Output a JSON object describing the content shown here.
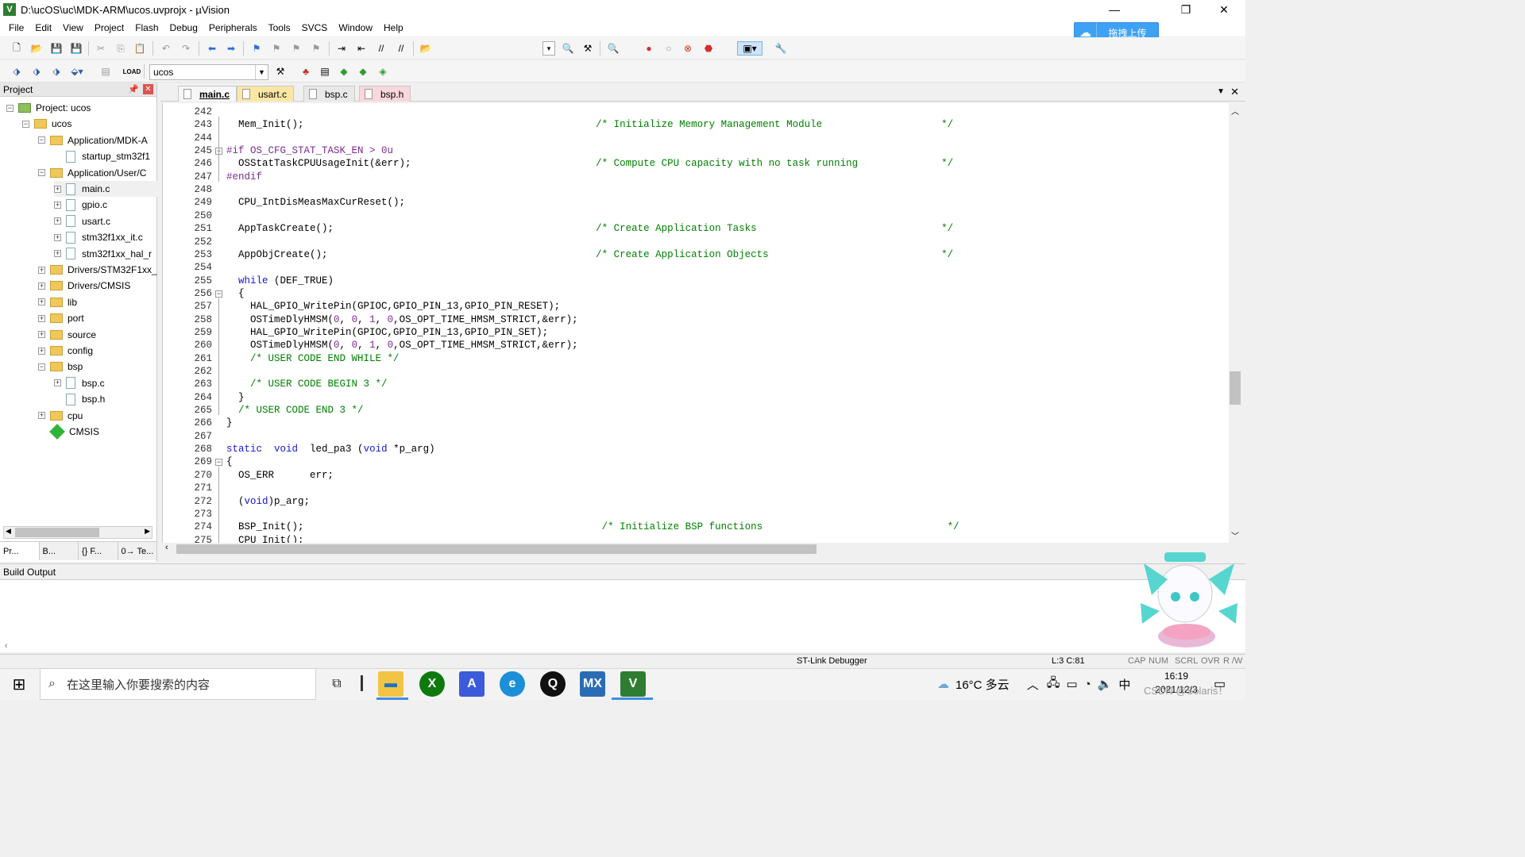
{
  "window": {
    "title": "D:\\ucOS\\uc\\MDK-ARM\\ucos.uvprojx - µVision",
    "minimize": "—",
    "maximize": "❐",
    "close": "✕"
  },
  "menu": [
    "File",
    "Edit",
    "View",
    "Project",
    "Flash",
    "Debug",
    "Peripherals",
    "Tools",
    "SVCS",
    "Window",
    "Help"
  ],
  "upload_button": {
    "label": "拖拽上传",
    "icon": "cloud-icon"
  },
  "toolbar2": {
    "target": "ucos"
  },
  "project_panel": {
    "title": "Project",
    "tree": [
      {
        "label": "Project: ucos",
        "icon": "project-icon",
        "expander": "−"
      },
      {
        "label": "ucos",
        "icon": "target-icon",
        "expander": "−"
      },
      {
        "label": "Application/MDK-A",
        "icon": "folder-icon",
        "expander": "−"
      },
      {
        "label": "startup_stm32f1",
        "icon": "file-icon",
        "expander": ""
      },
      {
        "label": "Application/User/C",
        "icon": "folder-icon",
        "expander": "−"
      },
      {
        "label": "main.c",
        "icon": "file-icon",
        "expander": "+"
      },
      {
        "label": "gpio.c",
        "icon": "file-icon",
        "expander": "+"
      },
      {
        "label": "usart.c",
        "icon": "file-icon",
        "expander": "+"
      },
      {
        "label": "stm32f1xx_it.c",
        "icon": "file-icon",
        "expander": "+"
      },
      {
        "label": "stm32f1xx_hal_r",
        "icon": "file-icon",
        "expander": "+"
      },
      {
        "label": "Drivers/STM32F1xx_",
        "icon": "folder-icon",
        "expander": "+"
      },
      {
        "label": "Drivers/CMSIS",
        "icon": "folder-icon",
        "expander": "+"
      },
      {
        "label": "lib",
        "icon": "folder-icon",
        "expander": "+"
      },
      {
        "label": "port",
        "icon": "folder-icon",
        "expander": "+"
      },
      {
        "label": "source",
        "icon": "folder-icon",
        "expander": "+"
      },
      {
        "label": "config",
        "icon": "folder-icon",
        "expander": "+"
      },
      {
        "label": "bsp",
        "icon": "folder-icon",
        "expander": "−"
      },
      {
        "label": "bsp.c",
        "icon": "file-icon",
        "expander": "+"
      },
      {
        "label": "bsp.h",
        "icon": "file-icon",
        "expander": ""
      },
      {
        "label": "cpu",
        "icon": "folder-icon",
        "expander": "+"
      },
      {
        "label": "CMSIS",
        "icon": "gem-icon",
        "expander": ""
      }
    ],
    "tabs": [
      "Pr...",
      "B...",
      "{} F...",
      "0→ Te..."
    ]
  },
  "editor": {
    "tabs": [
      {
        "label": "main.c",
        "color": "#f6f6f6",
        "active": true
      },
      {
        "label": "usart.c",
        "color": "#fbe7a5"
      },
      {
        "label": "bsp.c",
        "color": "#e9e9e9"
      },
      {
        "label": "bsp.h",
        "color": "#f9d7dc"
      }
    ],
    "lines": [
      {
        "n": "242",
        "t": ""
      },
      {
        "n": "243",
        "t": "  Mem_Init();                                                 /* Initialize Memory Management Module                    */"
      },
      {
        "n": "244",
        "t": ""
      },
      {
        "n": "245",
        "t": "#if OS_CFG_STAT_TASK_EN > 0u"
      },
      {
        "n": "246",
        "t": "  OSStatTaskCPUUsageInit(&err);                               /* Compute CPU capacity with no task running              */"
      },
      {
        "n": "247",
        "t": "#endif"
      },
      {
        "n": "248",
        "t": ""
      },
      {
        "n": "249",
        "t": "  CPU_IntDisMeasMaxCurReset();"
      },
      {
        "n": "250",
        "t": ""
      },
      {
        "n": "251",
        "t": "  AppTaskCreate();                                            /* Create Application Tasks                               */"
      },
      {
        "n": "252",
        "t": ""
      },
      {
        "n": "253",
        "t": "  AppObjCreate();                                             /* Create Application Objects                             */"
      },
      {
        "n": "254",
        "t": ""
      },
      {
        "n": "255",
        "t": "  while (DEF_TRUE)"
      },
      {
        "n": "256",
        "t": "  {"
      },
      {
        "n": "257",
        "t": "    HAL_GPIO_WritePin(GPIOC,GPIO_PIN_13,GPIO_PIN_RESET);"
      },
      {
        "n": "258",
        "t": "    OSTimeDlyHMSM(0, 0, 1, 0,OS_OPT_TIME_HMSM_STRICT,&err);"
      },
      {
        "n": "259",
        "t": "    HAL_GPIO_WritePin(GPIOC,GPIO_PIN_13,GPIO_PIN_SET);"
      },
      {
        "n": "260",
        "t": "    OSTimeDlyHMSM(0, 0, 1, 0,OS_OPT_TIME_HMSM_STRICT,&err);"
      },
      {
        "n": "261",
        "t": "    /* USER CODE END WHILE */"
      },
      {
        "n": "262",
        "t": ""
      },
      {
        "n": "263",
        "t": "    /* USER CODE BEGIN 3 */"
      },
      {
        "n": "264",
        "t": "  }"
      },
      {
        "n": "265",
        "t": "  /* USER CODE END 3 */"
      },
      {
        "n": "266",
        "t": "}"
      },
      {
        "n": "267",
        "t": ""
      },
      {
        "n": "268",
        "t": "static  void  led_pa3 (void *p_arg)"
      },
      {
        "n": "269",
        "t": "{"
      },
      {
        "n": "270",
        "t": "  OS_ERR      err;"
      },
      {
        "n": "271",
        "t": ""
      },
      {
        "n": "272",
        "t": "  (void)p_arg;"
      },
      {
        "n": "273",
        "t": ""
      },
      {
        "n": "274",
        "t": "  BSP_Init();                                                  /* Initialize BSP functions                               */"
      },
      {
        "n": "275",
        "t": "  CPU_Init();"
      }
    ]
  },
  "build_output": {
    "title": "Build Output"
  },
  "status": {
    "debugger": "ST-Link Debugger",
    "cursor": "L:3 C:81",
    "flags": [
      "CAP",
      "NUM",
      "SCRL",
      "OVR",
      "R /W"
    ]
  },
  "taskbar": {
    "search_placeholder": "在这里输入你要搜索的内容",
    "apps": [
      {
        "name": "task-view-icon",
        "glyph": "⧉"
      },
      {
        "name": "file-explorer-icon",
        "glyph": "▬"
      },
      {
        "name": "xbox-icon",
        "glyph": "X"
      },
      {
        "name": "vscode-icon",
        "glyph": "A"
      },
      {
        "name": "edge-icon",
        "glyph": "e"
      },
      {
        "name": "qq-icon",
        "glyph": "Q"
      },
      {
        "name": "stm32cubemx-icon",
        "glyph": "MX"
      },
      {
        "name": "keil-icon",
        "glyph": "V"
      }
    ],
    "weather": "16°C 多云",
    "ime": "中",
    "time": "16:19",
    "date": "2021/12/3",
    "watermark": "CSDN @Solaris！"
  },
  "colors": {
    "keyword": "#1616d6",
    "comment": "#008000",
    "preprocessor": "#7b2b8f",
    "accent": "#3c8ee6"
  }
}
